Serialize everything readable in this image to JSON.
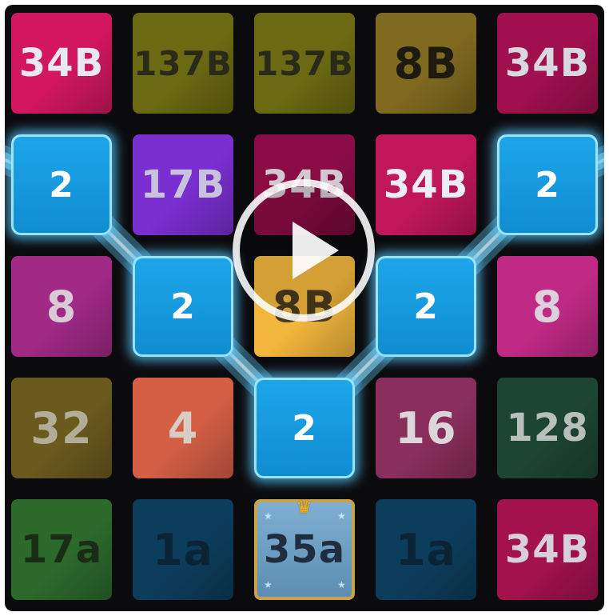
{
  "game": {
    "grid_rows": 5,
    "grid_cols": 5,
    "selected_chain_colors": {
      "fill": "#1599dd",
      "glow": "#63d2ff"
    },
    "tiles": [
      {
        "row": 0,
        "col": 0,
        "label": "34B",
        "color": "#d2175f",
        "text_color": "#e8e8ee"
      },
      {
        "row": 0,
        "col": 1,
        "label": "137B",
        "color": "#6b6a12",
        "text_color": "#2a2a1a"
      },
      {
        "row": 0,
        "col": 2,
        "label": "137B",
        "color": "#6b6a12",
        "text_color": "#2a2a1a"
      },
      {
        "row": 0,
        "col": 3,
        "label": "8B",
        "color": "#7f6a1f",
        "text_color": "#1e1a10"
      },
      {
        "row": 0,
        "col": 4,
        "label": "34B",
        "color": "#a0104f",
        "text_color": "#d8d8de"
      },
      {
        "row": 1,
        "col": 0,
        "label": "2",
        "color": "#1599dd",
        "text_color": "#ffffff",
        "selected": true
      },
      {
        "row": 1,
        "col": 1,
        "label": "17B",
        "color": "#7a2fd0",
        "text_color": "#c9c2dd"
      },
      {
        "row": 1,
        "col": 2,
        "label": "34B",
        "color": "#8a0c45",
        "text_color": "#d2c8d0"
      },
      {
        "row": 1,
        "col": 3,
        "label": "34B",
        "color": "#c0175a",
        "text_color": "#ececf2"
      },
      {
        "row": 1,
        "col": 4,
        "label": "2",
        "color": "#1599dd",
        "text_color": "#ffffff",
        "selected": true
      },
      {
        "row": 2,
        "col": 0,
        "label": "8",
        "color": "#a02a86",
        "text_color": "#d9cbd6"
      },
      {
        "row": 2,
        "col": 1,
        "label": "2",
        "color": "#1599dd",
        "text_color": "#ffffff",
        "selected": true
      },
      {
        "row": 2,
        "col": 2,
        "label": "8B",
        "color": "#f2b63c",
        "text_color": "#4a3a1e"
      },
      {
        "row": 2,
        "col": 3,
        "label": "2",
        "color": "#1599dd",
        "text_color": "#ffffff",
        "selected": true
      },
      {
        "row": 2,
        "col": 4,
        "label": "8",
        "color": "#c02a86",
        "text_color": "#dcd0dc"
      },
      {
        "row": 3,
        "col": 0,
        "label": "32",
        "color": "#6b5a1e",
        "text_color": "#b3ad98"
      },
      {
        "row": 3,
        "col": 1,
        "label": "4",
        "color": "#d45f45",
        "text_color": "#d8cdc6"
      },
      {
        "row": 3,
        "col": 2,
        "label": "2",
        "color": "#1599dd",
        "text_color": "#ffffff",
        "selected": true
      },
      {
        "row": 3,
        "col": 3,
        "label": "16",
        "color": "#8a2f5c",
        "text_color": "#dcd6da"
      },
      {
        "row": 3,
        "col": 4,
        "label": "128",
        "color": "#1d4534",
        "text_color": "#b8bfbc"
      },
      {
        "row": 4,
        "col": 0,
        "label": "17a",
        "color": "#2c6a2c",
        "text_color": "#1a2c16"
      },
      {
        "row": 4,
        "col": 1,
        "label": "1a",
        "color": "#0d3d5c",
        "text_color": "#0b2434"
      },
      {
        "row": 4,
        "col": 2,
        "label": "35a",
        "color": "#6b9bbf",
        "text_color": "#1f2e3e",
        "crown": true
      },
      {
        "row": 4,
        "col": 3,
        "label": "1a",
        "color": "#0d3d5c",
        "text_color": "#0b2434"
      },
      {
        "row": 4,
        "col": 4,
        "label": "34B",
        "color": "#a3124f",
        "text_color": "#d8d0d8"
      }
    ],
    "chain": [
      [
        1,
        0
      ],
      [
        2,
        1
      ],
      [
        3,
        2
      ],
      [
        2,
        3
      ],
      [
        1,
        4
      ]
    ],
    "play_overlay": {
      "icon": "play-icon",
      "visible": true
    }
  }
}
